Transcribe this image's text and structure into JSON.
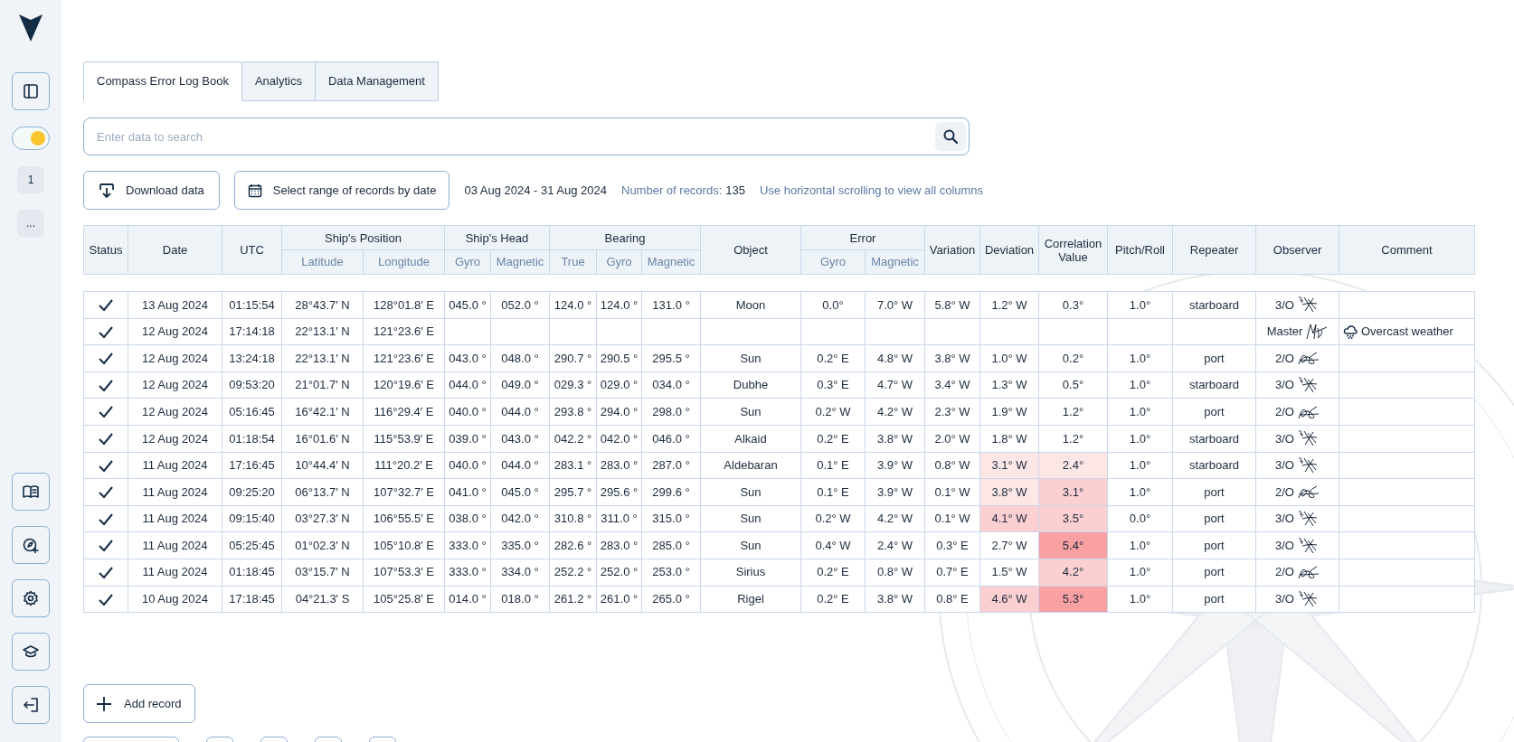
{
  "sidebar": {
    "top_buttons": [
      {
        "kind": "panel"
      }
    ],
    "theme_toggle": {
      "on": true
    },
    "chips": [
      "1",
      "..."
    ],
    "bottom_buttons": [
      {
        "kind": "book"
      },
      {
        "kind": "compass-plus"
      },
      {
        "kind": "settings"
      },
      {
        "kind": "education"
      },
      {
        "kind": "logout"
      }
    ]
  },
  "tabs": [
    {
      "label": "Compass Error Log Book",
      "selected": true
    },
    {
      "label": "Analytics",
      "selected": false
    },
    {
      "label": "Data Management",
      "selected": false
    }
  ],
  "search": {
    "placeholder": "Enter data to search"
  },
  "toolbar": {
    "download_button": "Download data",
    "range_button": "Select range of records by date",
    "date_range": "03 Aug 2024 - 31 Aug 2024",
    "records_label": "Number of records:",
    "records_count": "135",
    "hint": "Use horizontal scrolling to view all columns"
  },
  "table": {
    "columns": [
      {
        "label": "Status"
      },
      {
        "label": "Date"
      },
      {
        "label": "UTC"
      },
      {
        "label": "Ship's Position",
        "colspan": 2,
        "children": [
          "Latitude",
          "Longitude"
        ]
      },
      {
        "label": "Ship's Head",
        "colspan": 2,
        "children": [
          "Gyro",
          "Magnetic"
        ]
      },
      {
        "label": "Bearing",
        "colspan": 3,
        "children": [
          "True",
          "Gyro",
          "Magnetic"
        ]
      },
      {
        "label": "Object"
      },
      {
        "label": "Error",
        "colspan": 2,
        "children": [
          "Gyro",
          "Magnetic"
        ]
      },
      {
        "label": "Variation"
      },
      {
        "label": "Deviation"
      },
      {
        "label": "Correlation Value"
      },
      {
        "label": "Pitch/Roll"
      },
      {
        "label": "Repeater"
      },
      {
        "label": "Observer"
      },
      {
        "label": "Comment"
      }
    ],
    "rows": [
      {
        "cells": [
          {
            "checked": true
          },
          "13 Aug 2024",
          "01:15:54",
          "28°43.7′ N",
          "128°01.8′ E",
          "045.0 °",
          "052.0 °",
          "124.0 °",
          "124.0 °",
          "131.0 °",
          "Moon",
          "0.0°",
          "7.0° W",
          "5.8° W",
          "1.2° W",
          "0.3°",
          "1.0°",
          "starboard",
          {
            "rank": "3/O",
            "kind": "third"
          },
          ""
        ]
      },
      {
        "cells": [
          {
            "checked": true
          },
          "12 Aug 2024",
          "17:14:18",
          "22°13.1′ N",
          "121°23.6′ E",
          "",
          "",
          "",
          "",
          "",
          "",
          "",
          "",
          "",
          "",
          "",
          "",
          "",
          {
            "rank": "Master",
            "kind": "master"
          },
          {
            "kind": "weather",
            "text": "Overcast weather"
          }
        ]
      },
      {
        "cells": [
          {
            "checked": true
          },
          "12 Aug 2024",
          "13:24:18",
          "22°13.1′ N",
          "121°23.6′ E",
          "043.0 °",
          "048.0 °",
          "290.7 °",
          "290.5 °",
          "295.5 °",
          "Sun",
          "0.2° E",
          "4.8° W",
          "3.8° W",
          "1.0° W",
          "0.2°",
          "1.0°",
          "port",
          {
            "rank": "2/O",
            "kind": "second"
          },
          ""
        ]
      },
      {
        "cells": [
          {
            "checked": true
          },
          "12 Aug 2024",
          "09:53:20",
          "21°01.7′ N",
          "120°19.6′ E",
          "044.0 °",
          "049.0 °",
          "029.3 °",
          "029.0 °",
          "034.0 °",
          "Dubhe",
          "0.3° E",
          "4.7° W",
          "3.4° W",
          "1.3° W",
          "0.5°",
          "1.0°",
          "starboard",
          {
            "rank": "3/O",
            "kind": "third"
          },
          ""
        ]
      },
      {
        "cells": [
          {
            "checked": true
          },
          "12 Aug 2024",
          "05:16:45",
          "16°42.1′ N",
          "116°29.4′ E",
          "040.0 °",
          "044.0 °",
          "293.8 °",
          "294.0 °",
          "298.0 °",
          "Sun",
          "0.2° W",
          "4.2° W",
          "2.3° W",
          "1.9° W",
          "1.2°",
          "1.0°",
          "port",
          {
            "rank": "2/O",
            "kind": "second"
          },
          ""
        ]
      },
      {
        "cells": [
          {
            "checked": true
          },
          "12 Aug 2024",
          "01:18:54",
          "16°01.6′ N",
          "115°53.9′ E",
          "039.0 °",
          "043.0 °",
          "042.2 °",
          "042.0 °",
          "046.0 °",
          "Alkaid",
          "0.2° E",
          "3.8° W",
          "2.0° W",
          "1.8° W",
          "1.2°",
          "1.0°",
          "starboard",
          {
            "rank": "3/O",
            "kind": "third"
          },
          ""
        ]
      },
      {
        "cells": [
          {
            "checked": true
          },
          "11 Aug 2024",
          "17:16:45",
          "10°44.4′ N",
          "111°20.2′ E",
          "040.0 °",
          "044.0 °",
          "283.1 °",
          "283.0 °",
          "287.0 °",
          "Aldebaran",
          "0.1° E",
          "3.9° W",
          "0.8° W",
          {
            "text": "3.1° W",
            "color": "#fde6e6"
          },
          {
            "text": "2.4°",
            "color": "#fde6e6"
          },
          "1.0°",
          "starboard",
          {
            "rank": "3/O",
            "kind": "third"
          },
          ""
        ]
      },
      {
        "cells": [
          {
            "checked": true
          },
          "11 Aug 2024",
          "09:25:20",
          "06°13.7′ N",
          "107°32.7′ E",
          "041.0 °",
          "045.0 °",
          "295.7 °",
          "295.6 °",
          "299.6 °",
          "Sun",
          "0.1° E",
          "3.9° W",
          "0.1° W",
          {
            "text": "3.8° W",
            "color": "#fde6e6"
          },
          {
            "text": "3.1°",
            "color": "#fccfd0"
          },
          "1.0°",
          "port",
          {
            "rank": "2/O",
            "kind": "second"
          },
          ""
        ]
      },
      {
        "cells": [
          {
            "checked": true
          },
          "11 Aug 2024",
          "09:15:40",
          "03°27.3′ N",
          "106°55.5′ E",
          "038.0 °",
          "042.0 °",
          "310.8 °",
          "311.0 °",
          "315.0 °",
          "Sun",
          "0.2° W",
          "4.2° W",
          "0.1° W",
          {
            "text": "4.1° W",
            "color": "#fccfd0"
          },
          {
            "text": "3.5°",
            "color": "#fccfd0"
          },
          "0.0°",
          "port",
          {
            "rank": "3/O",
            "kind": "third"
          },
          ""
        ]
      },
      {
        "cells": [
          {
            "checked": true
          },
          "11 Aug 2024",
          "05:25:45",
          "01°02.3′ N",
          "105°10.8′ E",
          "333.0 °",
          "335.0 °",
          "282.6 °",
          "283.0 °",
          "285.0 °",
          "Sun",
          "0.4° W",
          "2.4° W",
          "0.3° E",
          "2.7° W",
          {
            "text": "5.4°",
            "color": "#f8a0a2"
          },
          "1.0°",
          "port",
          {
            "rank": "3/O",
            "kind": "third"
          },
          ""
        ]
      },
      {
        "cells": [
          {
            "checked": true
          },
          "11 Aug 2024",
          "01:18:45",
          "03°15.7′ N",
          "107°53.3′ E",
          "333.0 °",
          "334.0 °",
          "252.2 °",
          "252.0 °",
          "253.0 °",
          "Sirius",
          "0.2° E",
          "0.8° W",
          "0.7° E",
          "1.5° W",
          {
            "text": "4.2°",
            "color": "#fccfd0"
          },
          "1.0°",
          "port",
          {
            "rank": "2/O",
            "kind": "second"
          },
          ""
        ]
      },
      {
        "cells": [
          {
            "checked": true
          },
          "10 Aug 2024",
          "17:18:45",
          "04°21.3′ S",
          "105°25.8′ E",
          "014.0 °",
          "018.0 °",
          "261.2 °",
          "261.0 °",
          "265.0 °",
          "Rigel",
          "0.2° E",
          "3.8° W",
          "0.8° E",
          {
            "text": "4.6° W",
            "color": "#fccfd0"
          },
          {
            "text": "5.3°",
            "color": "#f8a0a2"
          },
          "1.0°",
          "port",
          {
            "rank": "3/O",
            "kind": "third"
          },
          ""
        ]
      }
    ]
  },
  "add_button": "Add record"
}
